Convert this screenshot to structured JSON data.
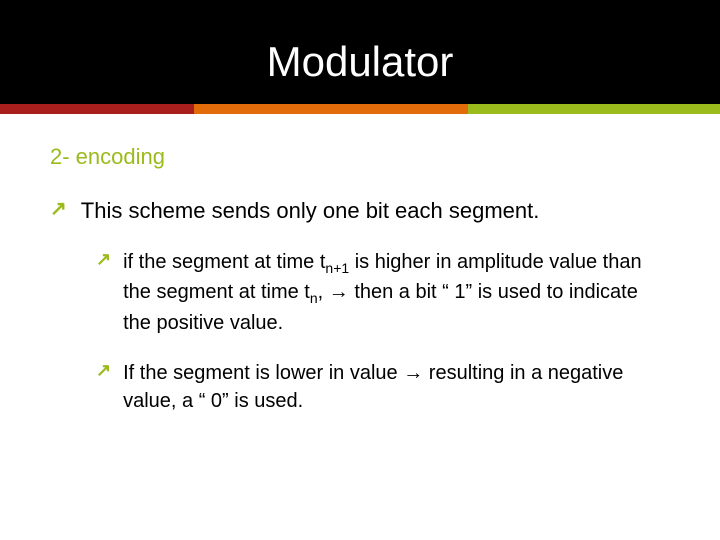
{
  "title": "Modulator",
  "subtitle": "2- encoding",
  "bullets": {
    "b1": "This scheme sends only one bit each segment.",
    "b2_pre": " if the segment at time t",
    "b2_sub1": "n+1",
    "b2_mid": " is higher in amplitude value than the segment at time t",
    "b2_sub2": "n",
    "b2_post": ", → then a bit “ 1” is used to indicate the positive value.",
    "b3": "If the segment is lower in value → resulting in a negative value, a “ 0” is used."
  },
  "icons": {
    "arrow": "↗"
  }
}
